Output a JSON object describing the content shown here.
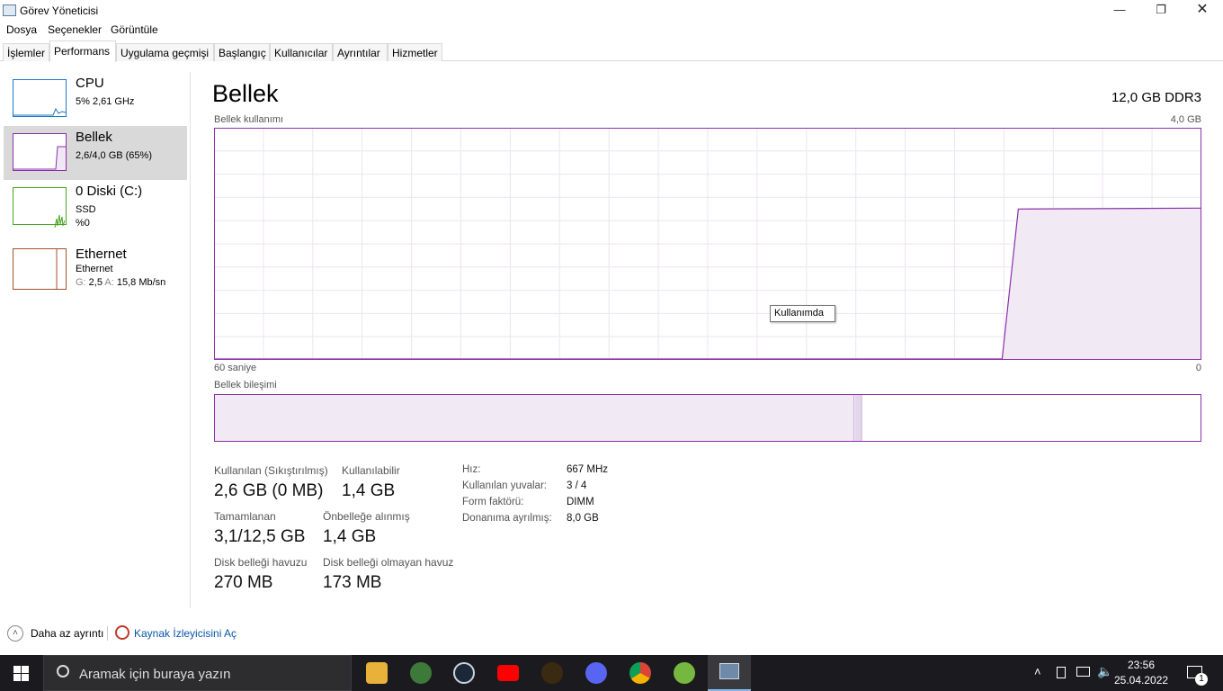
{
  "window": {
    "title": "Görev Yöneticisi"
  },
  "menu": [
    "Dosya",
    "Seçenekler",
    "Görüntüle"
  ],
  "tabs": [
    "İşlemler",
    "Performans",
    "Uygulama geçmişi",
    "Başlangıç",
    "Kullanıcılar",
    "Ayrıntılar",
    "Hizmetler"
  ],
  "sidebar": {
    "cpu": {
      "name": "CPU",
      "sub": "5% 2,61 GHz",
      "color": "#1e78c8"
    },
    "memory": {
      "name": "Bellek",
      "sub": "2,6/4,0 GB (65%)",
      "color": "#8b2fad"
    },
    "disk": {
      "name": "0 Diski (C:)",
      "sub1": "SSD",
      "sub2": "%0",
      "color": "#4aa520"
    },
    "ethernet": {
      "name": "Ethernet",
      "sub1": "Ethernet",
      "sub2_g": "G: ",
      "sub2_gv": "2,5 ",
      "sub2_a": "A: ",
      "sub2_av": "15,8 Mb/sn",
      "color": "#a0522d"
    }
  },
  "main": {
    "title": "Bellek",
    "spec": "12,0 GB DDR3",
    "usage_label": "Bellek kullanımı",
    "usage_max": "4,0 GB",
    "time_left": "60 saniye",
    "time_right": "0",
    "tooltip": "Kullanımda",
    "composition_label": "Bellek bileşimi",
    "composition": {
      "in_use_fraction": 0.648,
      "modified_fraction": 0.007
    },
    "usage_series": {
      "in_use_fraction_before": 0.0,
      "in_use_fraction_after": 0.65,
      "jump_time_fraction": 0.8
    },
    "stats": {
      "used_label": "Kullanılan (Sıkıştırılmış)",
      "used_value": "2,6 GB (0 MB)",
      "available_label": "Kullanılabilir",
      "available_value": "1,4 GB",
      "committed_label": "Tamamlanan",
      "committed_value": "3,1/12,5 GB",
      "cached_label": "Önbelleğe alınmış",
      "cached_value": "1,4 GB",
      "paged_label": "Disk belleği havuzu",
      "paged_value": "270 MB",
      "nonpaged_label": "Disk belleği olmayan havuz",
      "nonpaged_value": "173 MB"
    },
    "details": [
      {
        "k": "Hız:",
        "v": "667 MHz"
      },
      {
        "k": "Kullanılan yuvalar:",
        "v": "3 / 4"
      },
      {
        "k": "Form faktörü:",
        "v": "DIMM"
      },
      {
        "k": "Donanıma ayrılmış:",
        "v": "8,0 GB"
      }
    ]
  },
  "bottom": {
    "fewer_details": "Daha az ayrıntı",
    "resource_monitor": "Kaynak İzleyicisini Aç"
  },
  "taskbar": {
    "search_placeholder": "Aramak için buraya yazın",
    "time": "23:56",
    "date": "25.04.2022",
    "notifications": "1"
  }
}
